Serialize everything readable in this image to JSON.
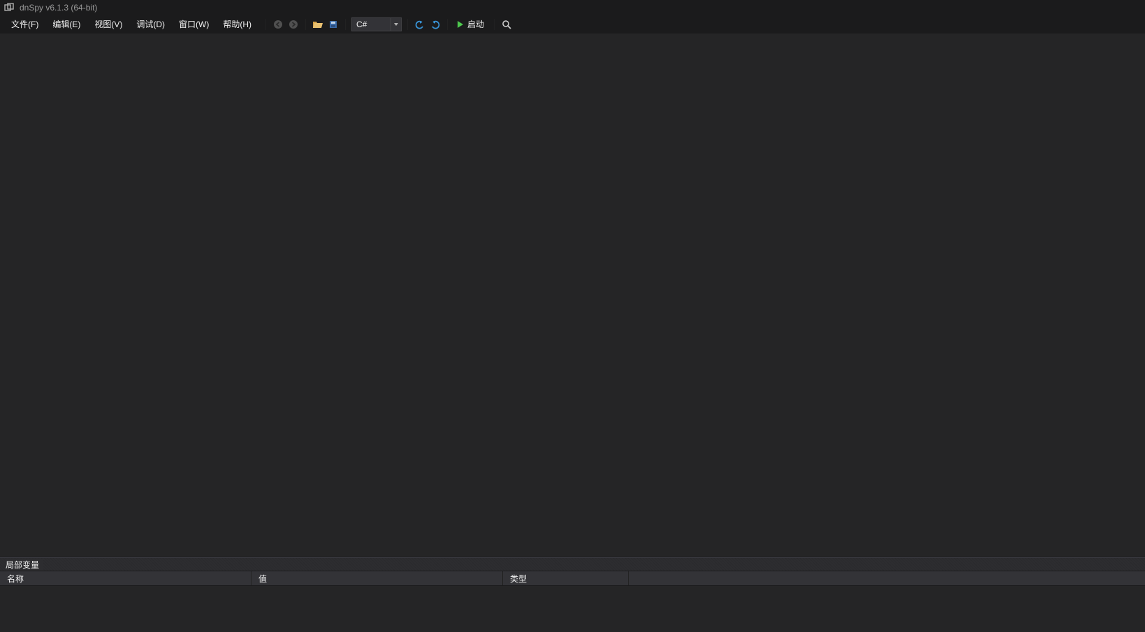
{
  "app": {
    "title": "dnSpy v6.1.3 (64-bit)"
  },
  "menu": {
    "file": "文件(F)",
    "edit": "编辑(E)",
    "view": "视图(V)",
    "debug": "调试(D)",
    "window": "窗口(W)",
    "help": "帮助(H)"
  },
  "toolbar": {
    "language_selected": "C#",
    "start_label": "启动"
  },
  "panel": {
    "title": "局部变量",
    "columns": {
      "name": "名称",
      "value": "值",
      "type": "类型"
    }
  }
}
